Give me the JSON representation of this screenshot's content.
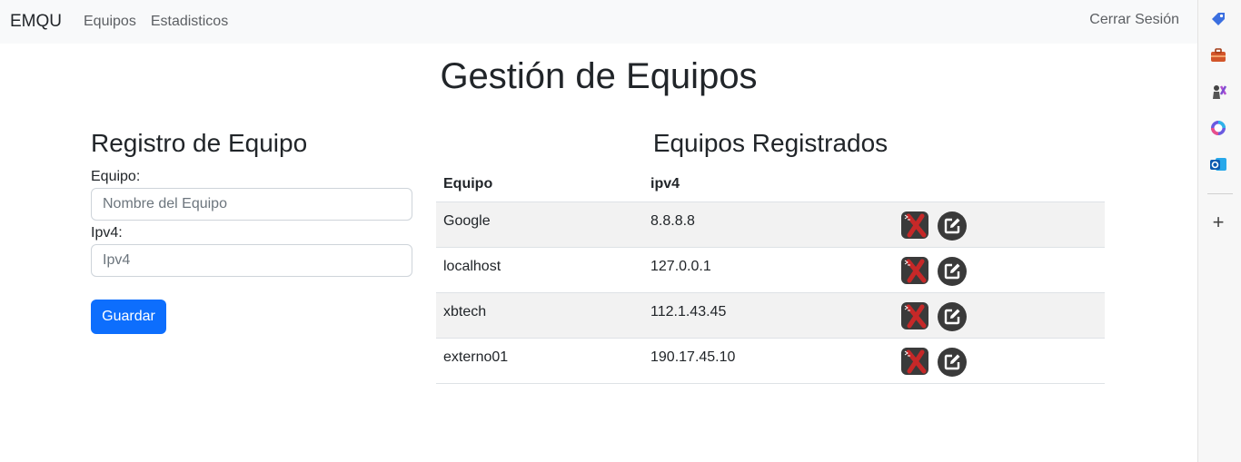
{
  "navbar": {
    "brand": "EMQU",
    "links": [
      "Equipos",
      "Estadisticos"
    ],
    "logout": "Cerrar Sesión"
  },
  "page": {
    "title": "Gestión de Equipos"
  },
  "form": {
    "title": "Registro de Equipo",
    "equipo_label": "Equipo:",
    "equipo_placeholder": "Nombre del Equipo",
    "equipo_value": "",
    "ipv4_label": "Ipv4:",
    "ipv4_placeholder": "Ipv4",
    "ipv4_value": "",
    "save_label": "Guardar"
  },
  "table": {
    "title": "Equipos Registrados",
    "headers": [
      "Equipo",
      "ipv4"
    ],
    "rows": [
      {
        "equipo": "Google",
        "ipv4": "8.8.8.8"
      },
      {
        "equipo": "localhost",
        "ipv4": "127.0.0.1"
      },
      {
        "equipo": "xbtech",
        "ipv4": "112.1.43.45"
      },
      {
        "equipo": "externo01",
        "ipv4": "190.17.45.10"
      }
    ],
    "delete_icon": "terminal-x-icon",
    "edit_icon": "edit-icon"
  },
  "side_panel": {
    "icons": [
      "tag-icon",
      "briefcase-icon",
      "chess-icon",
      "copilot-icon",
      "outlook-icon",
      "add-icon"
    ]
  },
  "colors": {
    "primary": "#0d6efd",
    "navbar_bg": "#f8f9fa",
    "striped_row": "#f2f2f2",
    "delete_red": "#c62828",
    "icon_dark": "#3a3a3a"
  }
}
